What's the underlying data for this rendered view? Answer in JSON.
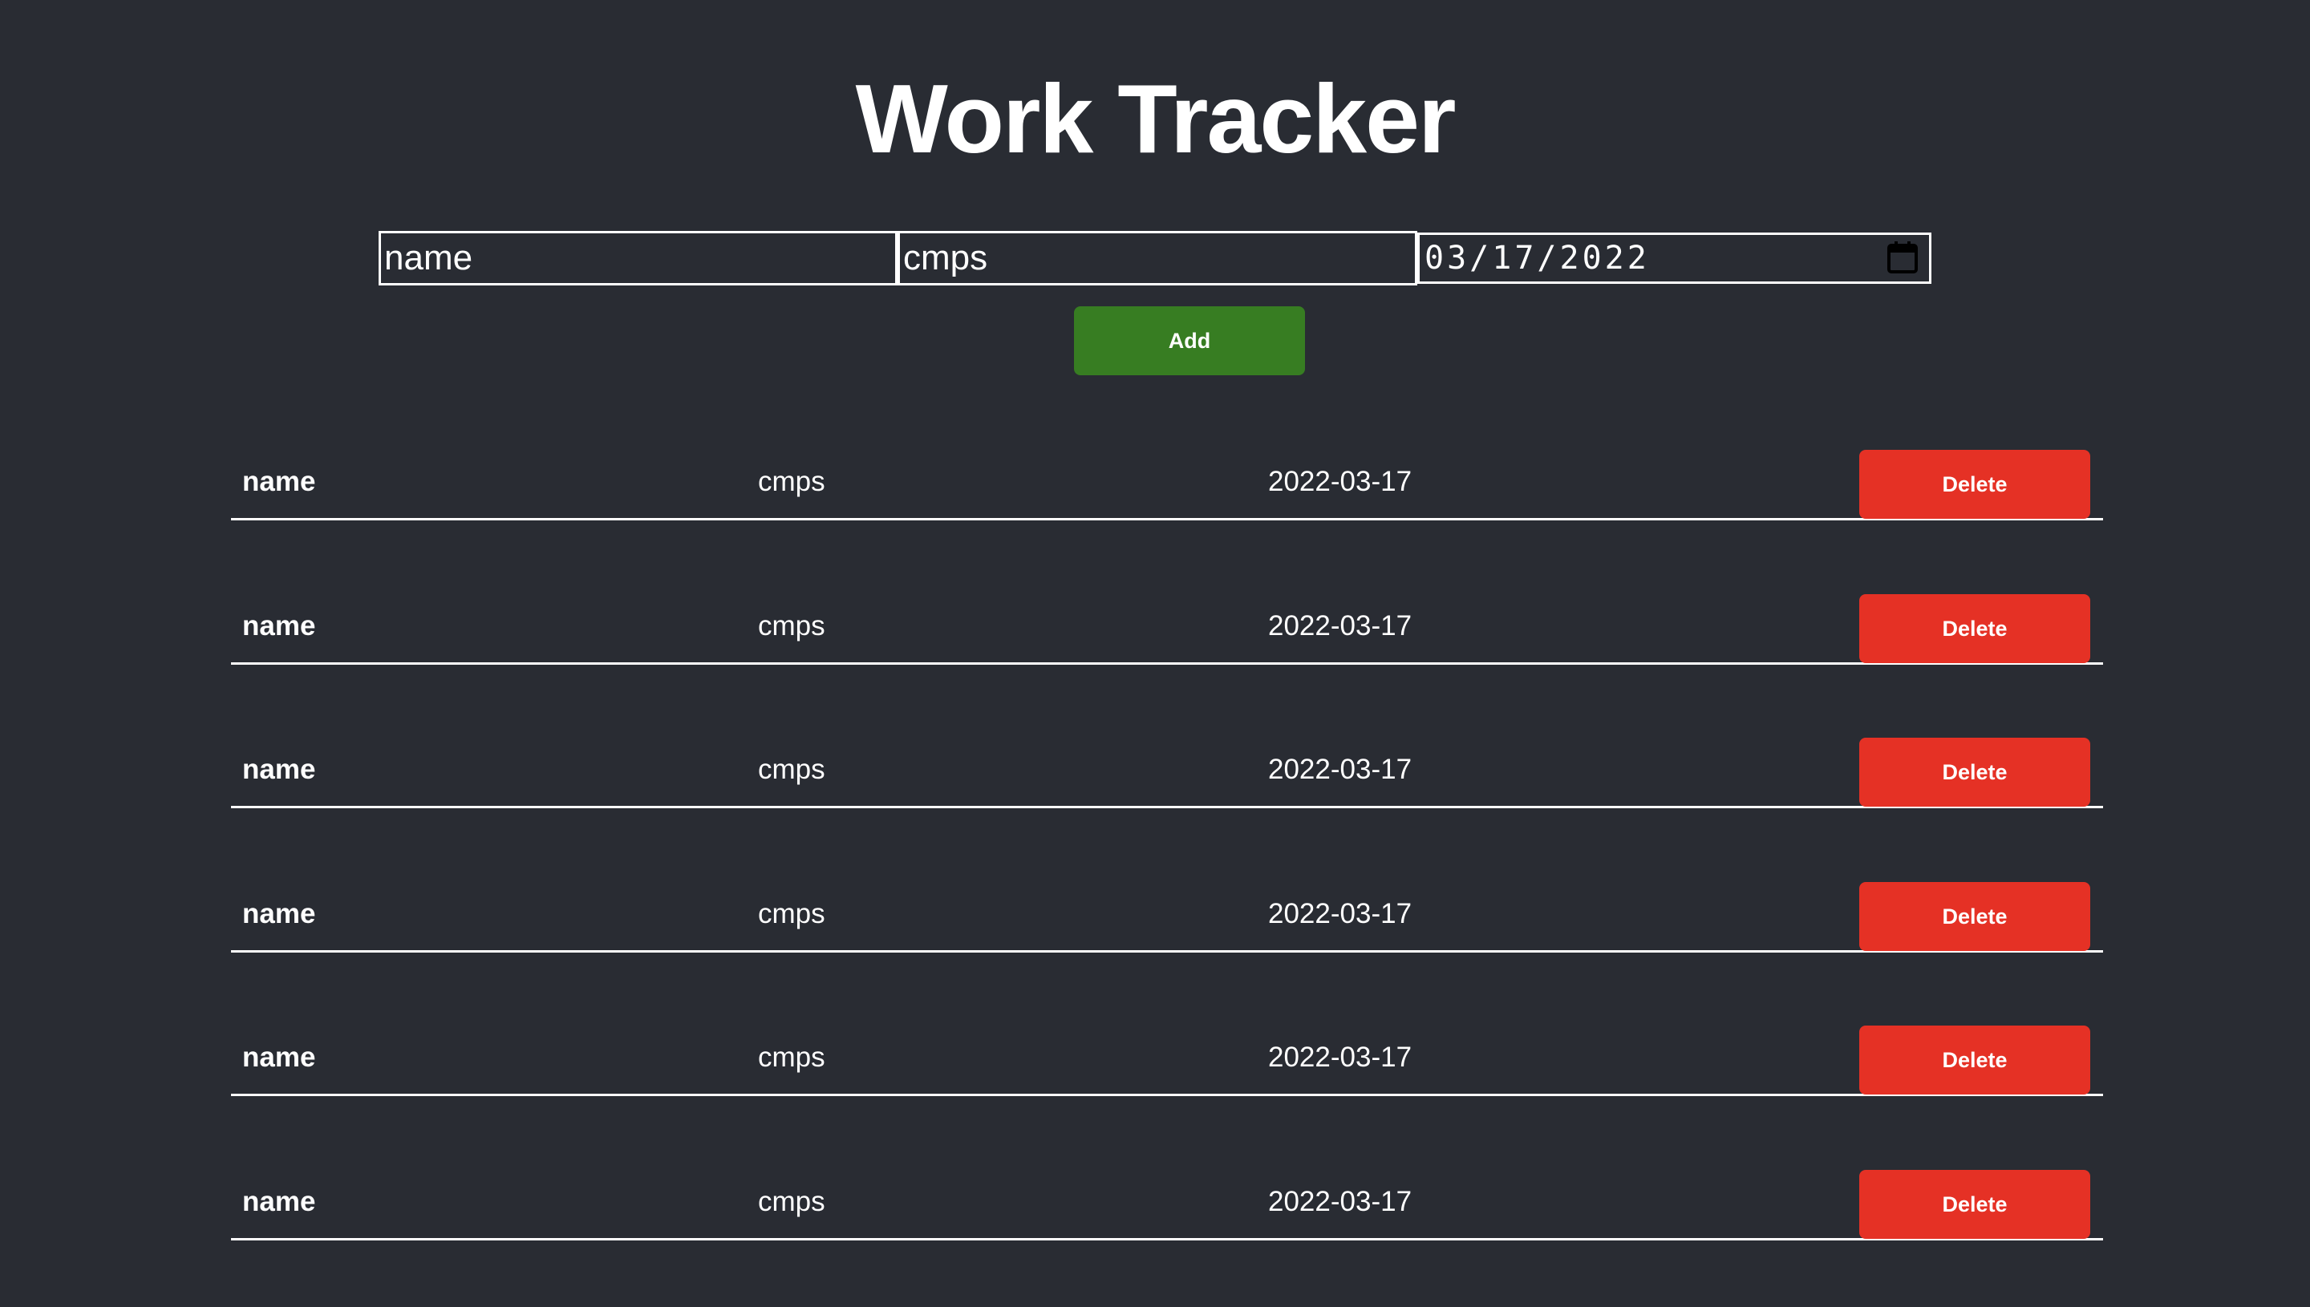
{
  "page": {
    "title": "Work Tracker"
  },
  "form": {
    "name_value": "name",
    "cmps_value": "cmps",
    "date_value": "03/17/2022",
    "date_icon": "calendar-icon",
    "add_label": "Add"
  },
  "colors": {
    "background": "#292c33",
    "add_button": "#377d22",
    "delete_button": "#e53125",
    "text": "#ffffff"
  },
  "entries": [
    {
      "name": "name",
      "cmps": "cmps",
      "date": "2022-03-17",
      "delete_label": "Delete"
    },
    {
      "name": "name",
      "cmps": "cmps",
      "date": "2022-03-17",
      "delete_label": "Delete"
    },
    {
      "name": "name",
      "cmps": "cmps",
      "date": "2022-03-17",
      "delete_label": "Delete"
    },
    {
      "name": "name",
      "cmps": "cmps",
      "date": "2022-03-17",
      "delete_label": "Delete"
    },
    {
      "name": "name",
      "cmps": "cmps",
      "date": "2022-03-17",
      "delete_label": "Delete"
    },
    {
      "name": "name",
      "cmps": "cmps",
      "date": "2022-03-17",
      "delete_label": "Delete"
    }
  ]
}
